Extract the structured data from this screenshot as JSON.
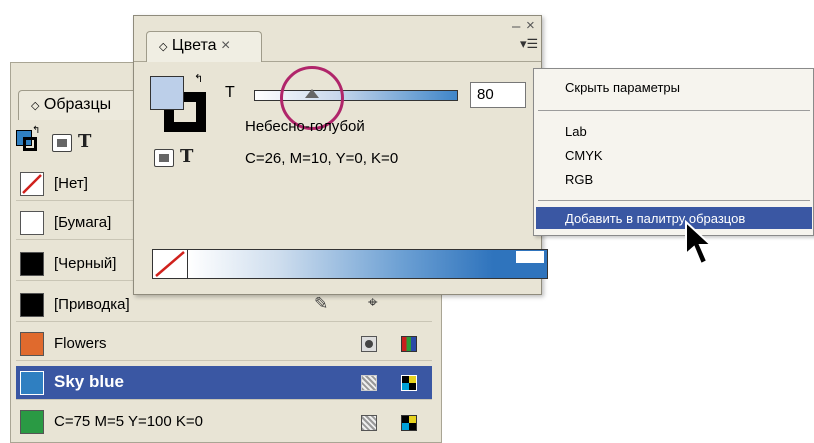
{
  "swatches_panel": {
    "tab_label": "Образцы",
    "rows": [
      {
        "name": "[Нет]",
        "color": "none"
      },
      {
        "name": "[Бумага]",
        "color": "#ffffff"
      },
      {
        "name": "[Черный]",
        "color": "#000000"
      },
      {
        "name": "[Приводка]",
        "color": "#000000"
      },
      {
        "name": "Flowers",
        "color": "#e06a2d"
      },
      {
        "name": "Sky blue",
        "color": "#2f7fc1",
        "selected": true
      },
      {
        "name": "C=75 M=5 Y=100 K=0",
        "color": "#2a9a44"
      }
    ]
  },
  "color_panel": {
    "tab_label": "Цвета",
    "close_glyph": "×",
    "minimize_glyph": "–",
    "menu_glyph": "▾☰",
    "tint_label": "T",
    "tint_value": "80",
    "swatch_name": "Небесно-голубой",
    "swatch_cmyk": "C=26, M=10, Y=0, K=0",
    "fill_color": "#bccfe9"
  },
  "panel_menu": {
    "items": [
      {
        "label": "Скрыть параметры"
      },
      {
        "label": "Lab"
      },
      {
        "label": "CMYK"
      },
      {
        "label": "RGB"
      },
      {
        "label": "Добавить в палитру образцов",
        "highlighted": true
      }
    ]
  }
}
